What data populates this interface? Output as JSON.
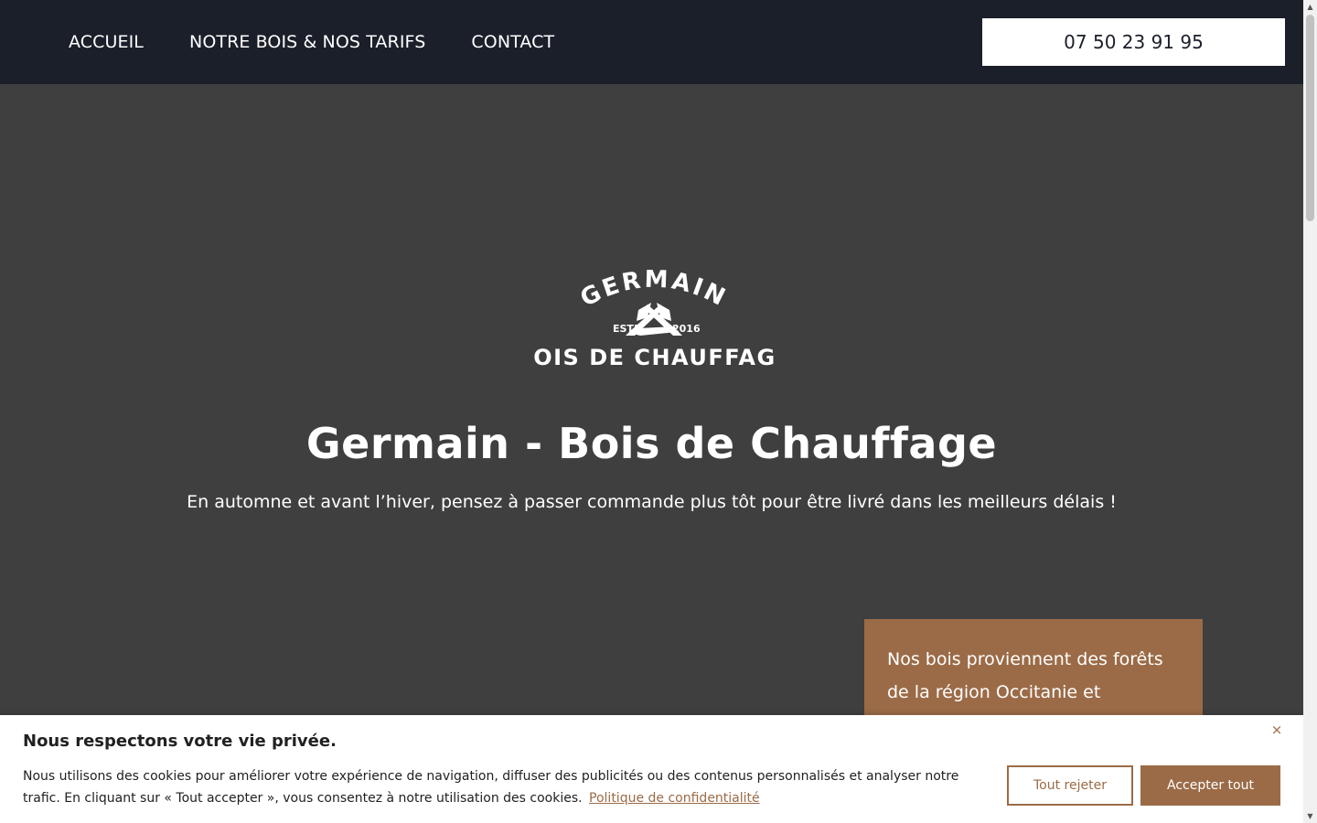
{
  "nav": {
    "items": [
      {
        "label": "ACCUEIL"
      },
      {
        "label": "NOTRE BOIS & NOS TARIFS"
      },
      {
        "label": "CONTACT"
      }
    ],
    "phone": "07 50 23 91 95"
  },
  "logo": {
    "top_text": "GERMAIN",
    "estd": "ESTD",
    "year": "2016",
    "bottom_text": "BOIS DE CHAUFFAGE"
  },
  "hero": {
    "title": "Germain - Bois de Chauffage",
    "subtitle": "En automne et avant l’hiver, pensez à passer commande plus tôt pour être livré dans les meilleurs délais !"
  },
  "card": {
    "text": "Nos bois proviennent des forêts de la région Occitanie et"
  },
  "cookie": {
    "title": "Nous respectons votre vie privée.",
    "text": "Nous utilisons des cookies pour améliorer votre expérience de navigation, diffuser des publicités ou des contenus personnalisés et analyser notre trafic. En cliquant sur « Tout accepter », vous consentez à notre utilisation des cookies.",
    "link": "Politique de confidentialité",
    "close": "×",
    "reject": "Tout rejeter",
    "accept": "Accepter tout"
  },
  "colors": {
    "header_bg": "#1b1f2a",
    "hero_bg": "#3f3f3f",
    "accent": "#9b6b47",
    "text_light": "#ffffff"
  },
  "icons": {
    "logo": "crossed-axes-icon",
    "close": "close-icon"
  }
}
